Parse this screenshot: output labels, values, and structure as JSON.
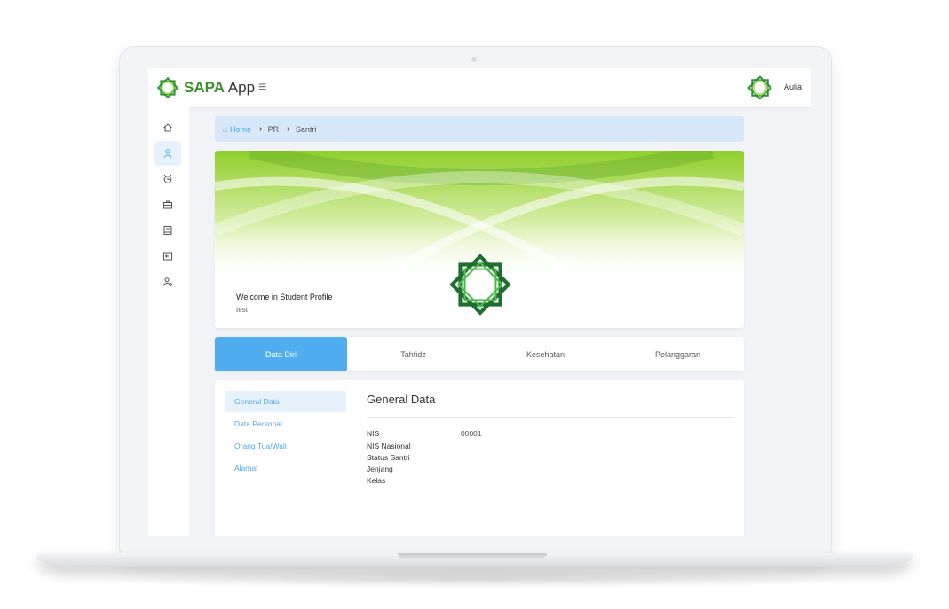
{
  "app": {
    "brand_part1": "SAPA",
    "brand_part2": " App",
    "menu_icon": "hamburger-icon",
    "user_name": "Aulia",
    "accent_color": "#3f8f2f",
    "primary_color": "#50aef0"
  },
  "sidebar": {
    "items": [
      {
        "icon": "home-icon",
        "active": false
      },
      {
        "icon": "user-icon",
        "active": true
      },
      {
        "icon": "alarm-clock-icon",
        "active": false
      },
      {
        "icon": "briefcase-icon",
        "active": false
      },
      {
        "icon": "book-icon",
        "active": false
      },
      {
        "icon": "exit-icon",
        "active": false
      },
      {
        "icon": "user-settings-icon",
        "active": false
      }
    ]
  },
  "breadcrumb": {
    "home": "Home",
    "items": [
      "PR",
      "Santri"
    ]
  },
  "profile": {
    "welcome_title": "Welcome in Student Profile",
    "welcome_subtitle": "test"
  },
  "tabs": [
    {
      "label": "Data Diri",
      "active": true
    },
    {
      "label": "Tahfidz",
      "active": false
    },
    {
      "label": "Kesehatan",
      "active": false
    },
    {
      "label": "Pelanggaran",
      "active": false
    }
  ],
  "sub_nav": [
    {
      "label": "General Data",
      "active": true
    },
    {
      "label": "Data Personal",
      "active": false
    },
    {
      "label": "Orang Tua/Wali",
      "active": false
    },
    {
      "label": "Alamat",
      "active": false
    }
  ],
  "general_data": {
    "title": "General Data",
    "fields": [
      {
        "label": "NIS",
        "value": "00001"
      },
      {
        "label": "NIS Nasional",
        "value": ""
      },
      {
        "label": "Status Santri",
        "value": ""
      },
      {
        "label": "Jenjang",
        "value": ""
      },
      {
        "label": "Kelas",
        "value": ""
      }
    ]
  }
}
